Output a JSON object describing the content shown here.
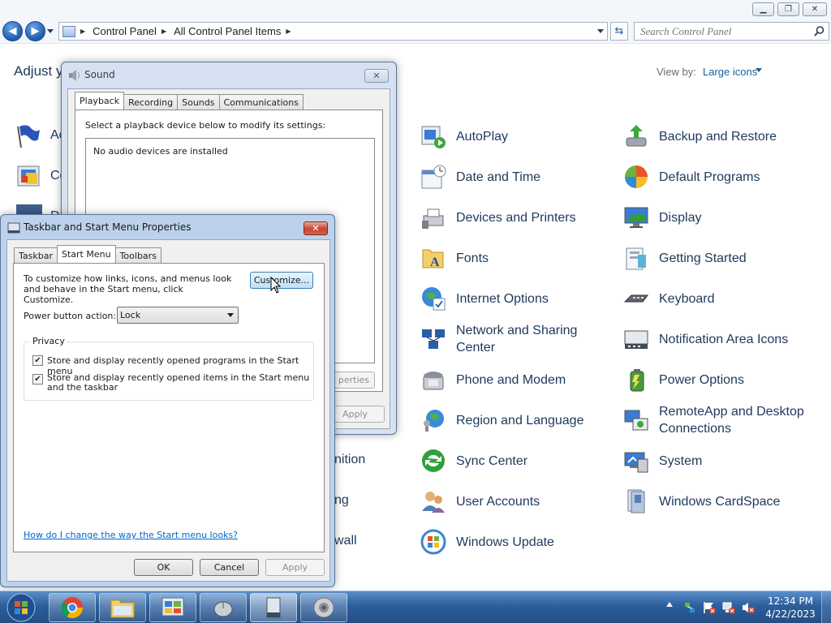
{
  "control_panel": {
    "breadcrumb": [
      "Control Panel",
      "All Control Panel Items"
    ],
    "search_placeholder": "Search Control Panel",
    "heading": "Adjust y",
    "view_by_label": "View by:",
    "view_by_value": "Large icons",
    "left_partial": [
      "Ac",
      "Co",
      "D"
    ],
    "mid_partial": [
      "nition",
      "ng",
      "wall"
    ],
    "items_col1": [
      {
        "label": "AutoPlay",
        "icon": "autoplay-icon"
      },
      {
        "label": "Date and Time",
        "icon": "calendar-clock-icon"
      },
      {
        "label": "Devices and Printers",
        "icon": "printer-icon"
      },
      {
        "label": "Fonts",
        "icon": "fonts-folder-icon"
      },
      {
        "label": "Internet Options",
        "icon": "globe-icon"
      },
      {
        "label": "Network and Sharing Center",
        "icon": "network-icon"
      },
      {
        "label": "Phone and Modem",
        "icon": "phone-icon"
      },
      {
        "label": "Region and Language",
        "icon": "region-globe-icon"
      },
      {
        "label": "Sync Center",
        "icon": "sync-icon"
      },
      {
        "label": "User Accounts",
        "icon": "users-icon"
      },
      {
        "label": "Windows Update",
        "icon": "windows-update-icon"
      }
    ],
    "items_col2": [
      {
        "label": "Backup and Restore",
        "icon": "backup-icon"
      },
      {
        "label": "Default Programs",
        "icon": "default-programs-icon"
      },
      {
        "label": "Display",
        "icon": "monitor-icon"
      },
      {
        "label": "Getting Started",
        "icon": "getting-started-icon"
      },
      {
        "label": "Keyboard",
        "icon": "keyboard-icon"
      },
      {
        "label": "Notification Area Icons",
        "icon": "notification-icon"
      },
      {
        "label": "Power Options",
        "icon": "battery-icon"
      },
      {
        "label": "RemoteApp and Desktop Connections",
        "icon": "remote-desktop-icon"
      },
      {
        "label": "System",
        "icon": "system-icon"
      },
      {
        "label": "Windows CardSpace",
        "icon": "cardspace-icon"
      }
    ]
  },
  "sound_dialog": {
    "title": "Sound",
    "tabs": [
      "Playback",
      "Recording",
      "Sounds",
      "Communications"
    ],
    "instruction": "Select a playback device below to modify its settings:",
    "empty_text": "No audio devices are installed",
    "properties_partial": "perties",
    "apply": "Apply"
  },
  "taskbar_dialog": {
    "title": "Taskbar and Start Menu Properties",
    "tabs": [
      "Taskbar",
      "Start Menu",
      "Toolbars"
    ],
    "description": "To customize how links, icons, and menus look and behave in the Start menu, click Customize.",
    "customize": "Customize...",
    "power_label": "Power button action:",
    "power_value": "Lock",
    "privacy_label": "Privacy",
    "privacy_opt1": "Store and display recently opened programs in the Start menu",
    "privacy_opt2": "Store and display recently opened items in the Start menu and the taskbar",
    "help_link": "How do I change the way the Start menu looks?",
    "ok": "OK",
    "cancel": "Cancel",
    "apply": "Apply"
  },
  "taskbar": {
    "time": "12:34 PM",
    "date": "4/22/2023"
  }
}
